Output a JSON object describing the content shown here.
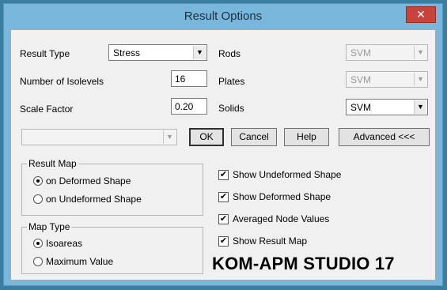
{
  "window": {
    "title": "Result Options",
    "close_glyph": "✕"
  },
  "fields": {
    "result_type": {
      "label": "Result Type",
      "value": "Stress"
    },
    "isolevels": {
      "label": "Number of Isolevels",
      "value": "16"
    },
    "scale_factor": {
      "label": "Scale Factor",
      "value": "0.20"
    },
    "rods": {
      "label": "Rods",
      "value": "SVM"
    },
    "plates": {
      "label": "Plates",
      "value": "SVM"
    },
    "solids": {
      "label": "Solids",
      "value": "SVM"
    },
    "preset": {
      "value": ""
    }
  },
  "buttons": {
    "ok": "OK",
    "cancel": "Cancel",
    "help": "Help",
    "advanced": "Advanced <<<"
  },
  "result_map": {
    "title": "Result Map",
    "options": [
      "on Deformed Shape",
      "on Undeformed Shape"
    ],
    "selected": "on Deformed Shape"
  },
  "map_type": {
    "title": "Map Type",
    "options": [
      "Isoareas",
      "Maximum Value"
    ],
    "selected": "Isoareas"
  },
  "checkboxes": [
    {
      "label": "Show Undeformed Shape",
      "checked": true
    },
    {
      "label": "Show Deformed Shape",
      "checked": true
    },
    {
      "label": "Averaged Node Values",
      "checked": true
    },
    {
      "label": "Show Result Map",
      "checked": true
    }
  ],
  "icons": {
    "dropdown": "▼",
    "check": "✔"
  },
  "brand": "KOM-APM STUDIO 17"
}
